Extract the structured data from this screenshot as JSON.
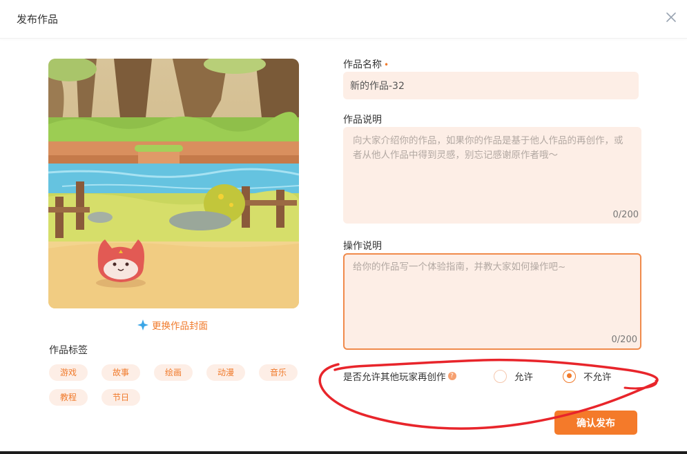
{
  "header": {
    "title": "发布作品",
    "close_icon": "close-icon"
  },
  "cover": {
    "change_label": "更换作品封面",
    "change_icon": "sparkle-star-icon"
  },
  "tags": {
    "label": "作品标签",
    "items": [
      "游戏",
      "故事",
      "绘画",
      "动漫",
      "音乐",
      "教程",
      "节日"
    ]
  },
  "form": {
    "name": {
      "label": "作品名称",
      "required_mark": "•",
      "value": "新的作品-32"
    },
    "description": {
      "label": "作品说明",
      "placeholder": "向大家介绍你的作品，如果你的作品是基于他人作品的再创作，或者从他人作品中得到灵感，别忘记感谢原作者哦～",
      "counter": "0/200"
    },
    "operation": {
      "label": "操作说明",
      "placeholder": "给你的作品写一个体验指南，并教大家如何操作吧~",
      "counter": "0/200"
    },
    "allow_remix": {
      "label": "是否允许其他玩家再创作",
      "help": "?",
      "options": [
        "允许",
        "不允许"
      ],
      "selected": "不允许"
    }
  },
  "actions": {
    "publish_label": "确认发布"
  },
  "colors": {
    "accent": "#f47a2a",
    "field_bg": "#fdeee6",
    "annotation": "#e8252b"
  }
}
